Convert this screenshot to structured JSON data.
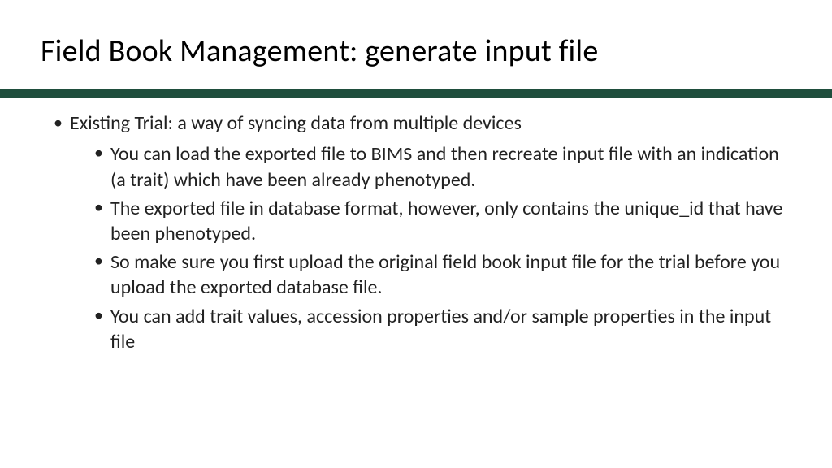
{
  "slide": {
    "title": "Field Book Management: generate input file",
    "main_bullet": "Existing Trial: a way of syncing data from multiple devices",
    "sub_bullets": [
      "You can load the exported file to BIMS and then recreate input file with an indication (a trait) which have been already phenotyped.",
      "The exported file in database format, however, only contains the unique_id that have been phenotyped.",
      "So make sure you first upload the original field book input file for the trial before you upload the exported database file.",
      "You can add trait values, accession properties and/or sample properties in the input file"
    ]
  }
}
